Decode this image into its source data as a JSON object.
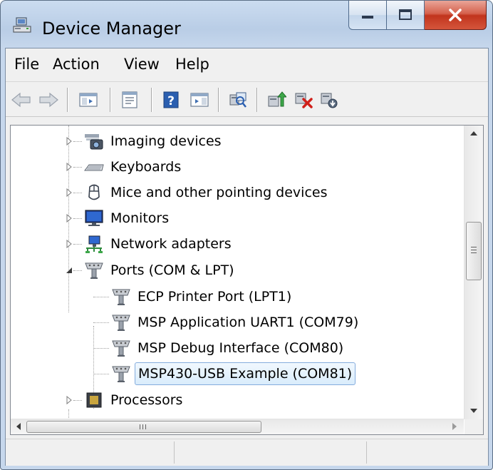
{
  "window": {
    "title": "Device Manager"
  },
  "menu": [
    "File",
    "Action",
    "View",
    "Help"
  ],
  "toolbar": [
    {
      "name": "back-icon"
    },
    {
      "name": "forward-icon"
    },
    {
      "name": "show-hide-console-tree-icon"
    },
    {
      "name": "properties-icon"
    },
    {
      "name": "help-icon"
    },
    {
      "name": "action-pane-icon"
    },
    {
      "name": "scan-hardware-changes-icon"
    },
    {
      "name": "update-driver-icon"
    },
    {
      "name": "uninstall-icon"
    },
    {
      "name": "disable-device-icon"
    }
  ],
  "tree": {
    "nodes": [
      {
        "label": "Imaging devices",
        "icon": "camera-icon",
        "level": 1,
        "expanded": false
      },
      {
        "label": "Keyboards",
        "icon": "keyboard-icon",
        "level": 1,
        "expanded": false
      },
      {
        "label": "Mice and other pointing devices",
        "icon": "mouse-icon",
        "level": 1,
        "expanded": false
      },
      {
        "label": "Monitors",
        "icon": "monitor-icon",
        "level": 1,
        "expanded": false
      },
      {
        "label": "Network adapters",
        "icon": "network-adapter-icon",
        "level": 1,
        "expanded": false
      },
      {
        "label": "Ports (COM & LPT)",
        "icon": "port-icon",
        "level": 1,
        "expanded": true
      },
      {
        "label": "ECP Printer Port (LPT1)",
        "icon": "port-icon",
        "level": 2
      },
      {
        "label": "MSP Application UART1 (COM79)",
        "icon": "port-icon",
        "level": 2
      },
      {
        "label": "MSP Debug Interface (COM80)",
        "icon": "port-icon",
        "level": 2
      },
      {
        "label": "MSP430-USB Example (COM81)",
        "icon": "port-icon",
        "level": 2,
        "selected": true
      },
      {
        "label": "Processors",
        "icon": "processor-icon",
        "level": 1,
        "expanded": false
      }
    ]
  },
  "scroll": {
    "vertical_position": 0.45,
    "horizontal_position": 0.0
  },
  "colors": {
    "selection_border": "#84acdd",
    "close_button": "#c7402a",
    "title_bar": "#c4d6ec"
  }
}
